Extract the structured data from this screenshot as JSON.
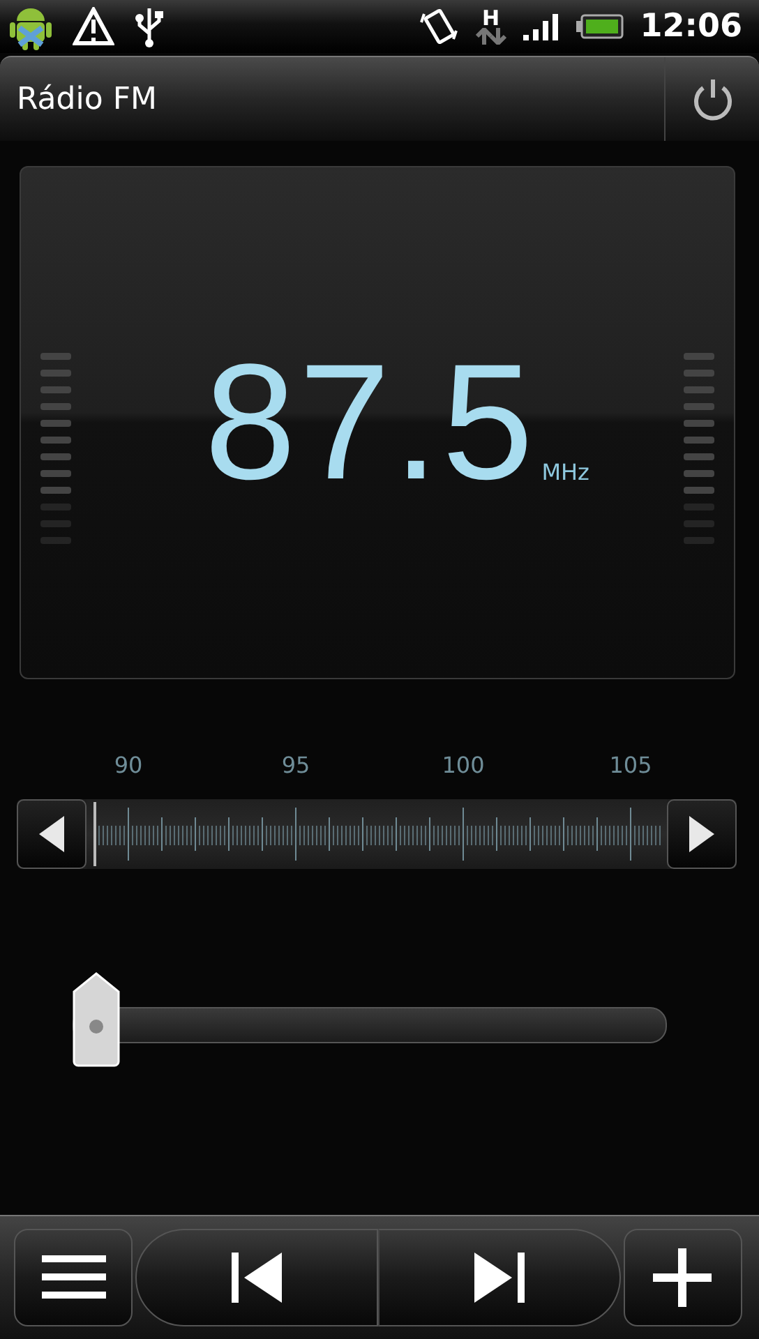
{
  "status_bar": {
    "network_type": "H",
    "time": "12:06"
  },
  "title_bar": {
    "title": "Rádio FM"
  },
  "display": {
    "frequency": "87.5",
    "unit": "MHz"
  },
  "tuner": {
    "scale_labels": [
      "90",
      "95",
      "100",
      "105"
    ],
    "level": 0
  },
  "volume": {
    "level": 0
  },
  "toolbar": {
    "buttons": [
      {
        "kind": "menu"
      },
      {
        "kind": "previous"
      },
      {
        "kind": "next"
      },
      {
        "kind": "add"
      }
    ]
  }
}
